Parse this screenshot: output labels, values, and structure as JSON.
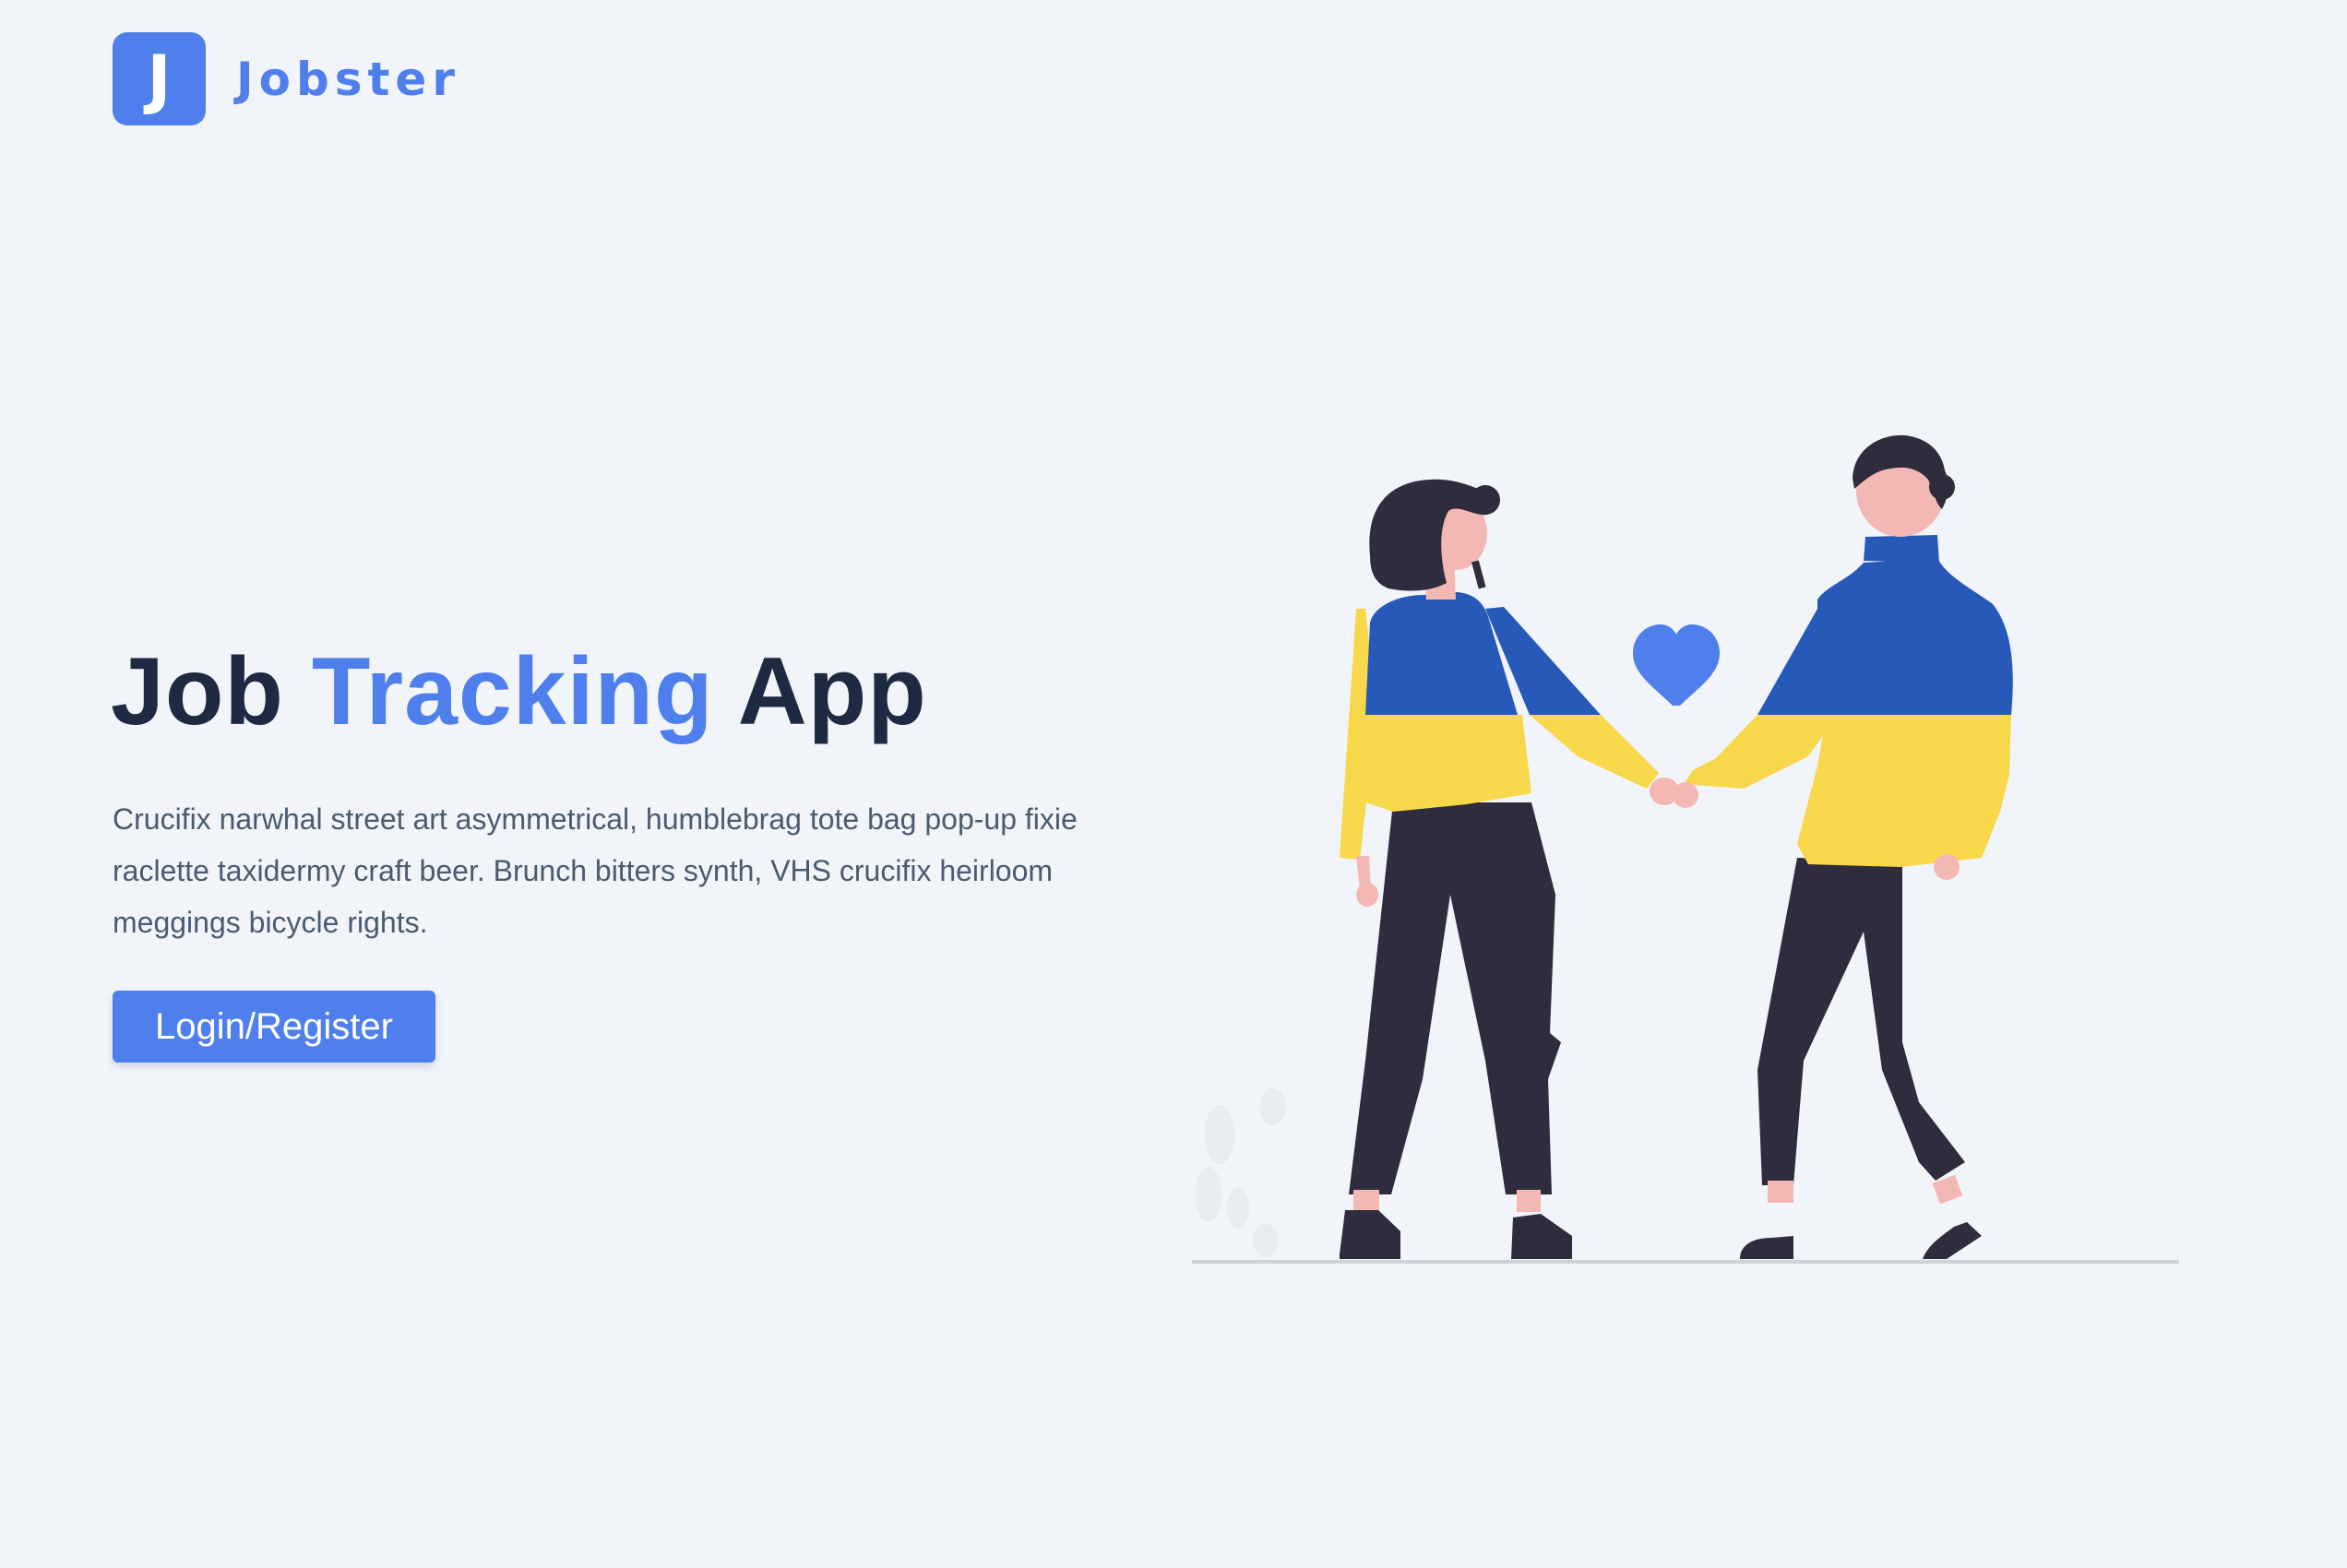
{
  "brand": {
    "logo_letter": "J",
    "name": "Jobster"
  },
  "hero": {
    "title_part1": "Job",
    "title_accent": "Tracking",
    "title_part2": "App",
    "description": "Crucifix narwhal street art asymmetrical, humblebrag tote bag pop-up fixie raclette taxidermy craft beer. Brunch bitters synth, VHS crucifix heirloom meggings bicycle rights.",
    "button_label": "Login/Register"
  },
  "illustration": {
    "icon": "couple-holding-hands-illustration",
    "heart_icon": "heart-icon"
  },
  "colors": {
    "background": "#f1f4f9",
    "primary": "#4f7fec",
    "title_dark": "#1e2a42",
    "text_muted": "#4b5b6f",
    "sweater_blue": "#2759b8",
    "sweater_yellow": "#f7d84a",
    "pants_dark": "#2e2c3d",
    "skin": "#f3b8b4"
  }
}
